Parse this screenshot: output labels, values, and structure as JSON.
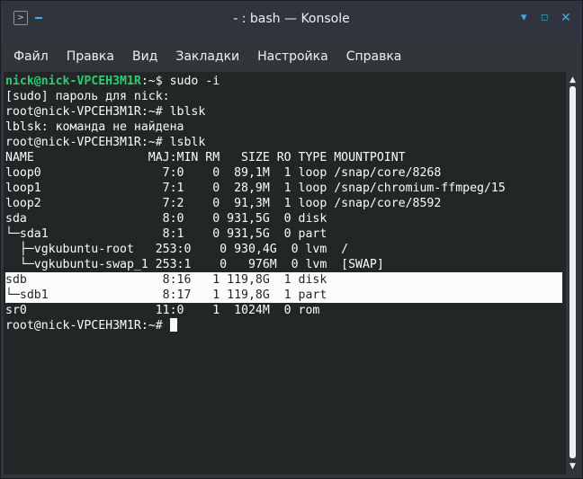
{
  "window": {
    "title": "- : bash — Konsole",
    "app_icon": "konsole-app-icon",
    "minimize_glyph": "▾",
    "maximize_glyph": "◻",
    "close_glyph": "✕"
  },
  "menu": [
    "Файл",
    "Правка",
    "Вид",
    "Закладки",
    "Настройка",
    "Справка"
  ],
  "terminal": {
    "prompt_user": "nick@nick-VPCEH3M1R",
    "prompt_root": "root@nick-VPCEH3M1R",
    "cmd1": ":~$ sudo -i",
    "sudo_prompt": "[sudo] пароль для nick:",
    "cmd2": ":~# lblsk",
    "error": "lblsk: команда не найдена",
    "cmd3": ":~# lsblk",
    "header": "NAME                MAJ:MIN RM   SIZE RO TYPE MOUNTPOINT",
    "rows": [
      "loop0                 7:0    0  89,1M  1 loop /snap/core/8268",
      "loop1                 7:1    0  28,9M  1 loop /snap/chromium-ffmpeg/15",
      "loop2                 7:2    0  91,3M  1 loop /snap/core/8592",
      "sda                   8:0    0 931,5G  0 disk",
      "└─sda1                8:1    0 931,5G  0 part",
      "  ├─vgkubuntu-root   253:0    0 930,4G  0 lvm  /",
      "  └─vgkubuntu-swap_1 253:1    0   976M  0 lvm  [SWAP]",
      "sdb                   8:16   1 119,8G  1 disk",
      "└─sdb1                8:17   1 119,8G  1 part",
      "sr0                  11:0    1  1024M  0 rom"
    ],
    "final_prompt": ":~# "
  },
  "scrollbar": {
    "up_glyph": "▲",
    "down_glyph": "▼"
  }
}
